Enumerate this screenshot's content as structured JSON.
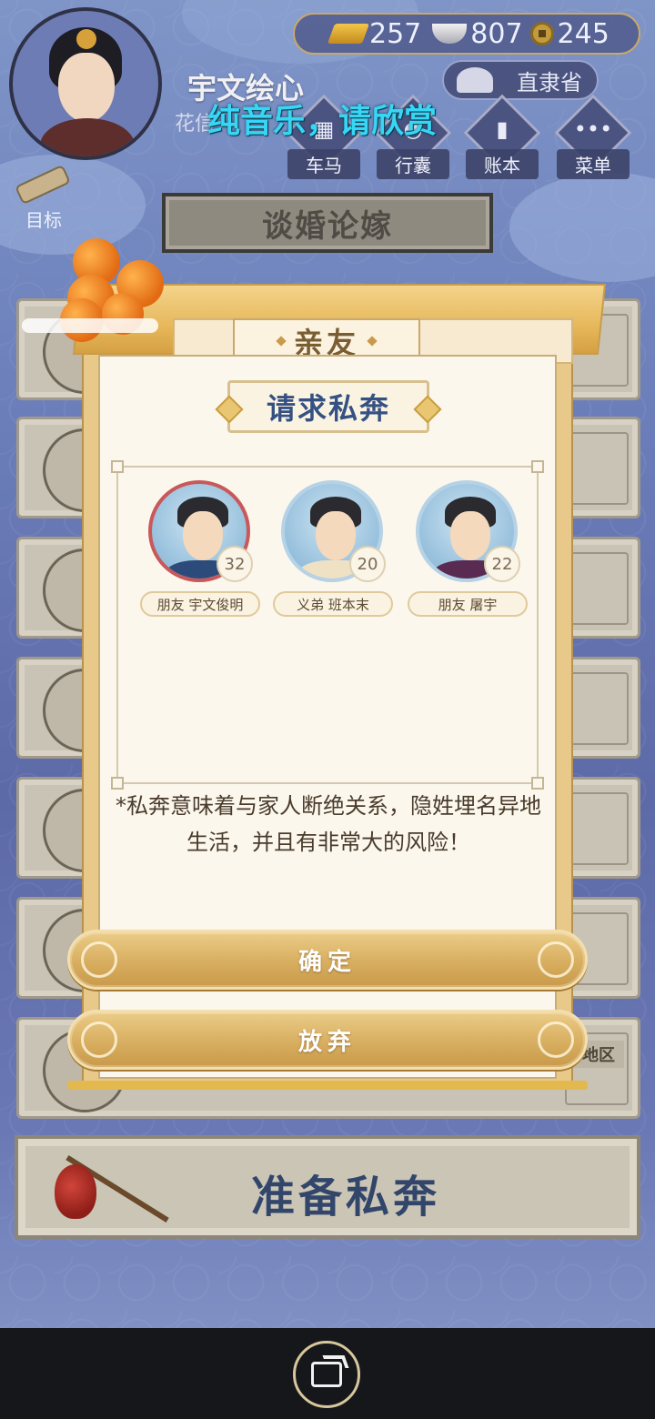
{
  "hud": {
    "player_name": "宇文绘心",
    "player_subname": "花信",
    "currency": {
      "gold": "257",
      "silver": "807",
      "coin": "245"
    },
    "province": "直隶省",
    "overlay_caption": "纯音乐，请欣赏",
    "menu": [
      {
        "label": "车马"
      },
      {
        "label": "行囊"
      },
      {
        "label": "账本"
      },
      {
        "label": "菜单"
      }
    ],
    "goal_label": "目标"
  },
  "screen_title": "谈婚论嫁",
  "dialog": {
    "tab_label": "亲友",
    "subtitle": "请求私奔",
    "people": [
      {
        "tag": "朋友 宇文俊明",
        "age": "32"
      },
      {
        "tag": "义弟 班本末",
        "age": "20"
      },
      {
        "tag": "朋友 屠宇",
        "age": "22"
      }
    ],
    "warning": "*私奔意味着与家人断绝关系，隐姓埋名异地生活，并且有非常大的风险！",
    "confirm_label": "确定",
    "cancel_label": "放弃"
  },
  "background": {
    "region_chip": "地区"
  },
  "elope_button_label": "准备私奔",
  "colors": {
    "accent_gold": "#d8ae60",
    "title_blue": "#355183",
    "caption_cyan": "#37d6f5"
  }
}
